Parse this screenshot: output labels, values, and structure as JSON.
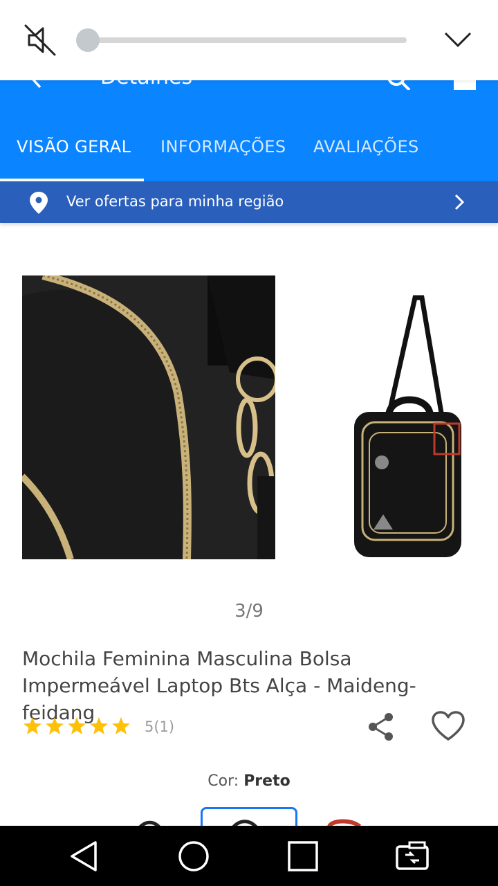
{
  "volume_overlay": {
    "muted_icon": "volume-mute-icon",
    "level_percent": 0,
    "collapse_icon": "chevron-down-icon"
  },
  "header": {
    "title": "Detalhes",
    "icons": [
      "back-arrow-icon",
      "search-icon",
      "cart-icon"
    ]
  },
  "tabs": [
    {
      "label": "VISÃO GERAL",
      "active": true
    },
    {
      "label": "INFORMAÇÕES",
      "active": false
    },
    {
      "label": "AVALIAÇÕES",
      "active": false
    }
  ],
  "region_banner": {
    "label": "Ver ofertas para minha região",
    "icon": "location-pin-icon"
  },
  "gallery": {
    "counter": "3/9"
  },
  "product": {
    "title": "Mochila Feminina Masculina Bolsa Impermeável Laptop Bts Alça - Maideng- feidang",
    "rating_stars": 5,
    "rating_text": "5(1)",
    "color_label": "Cor:",
    "color_value": "Preto"
  },
  "colors": {
    "header_blue": "#0a84ff",
    "banner_blue": "#2a5fbc",
    "star_yellow": "#ffc107"
  },
  "nav_bar": {
    "buttons": [
      "back-triangle-icon",
      "home-circle-icon",
      "recents-square-icon",
      "screen-switch-icon"
    ]
  }
}
